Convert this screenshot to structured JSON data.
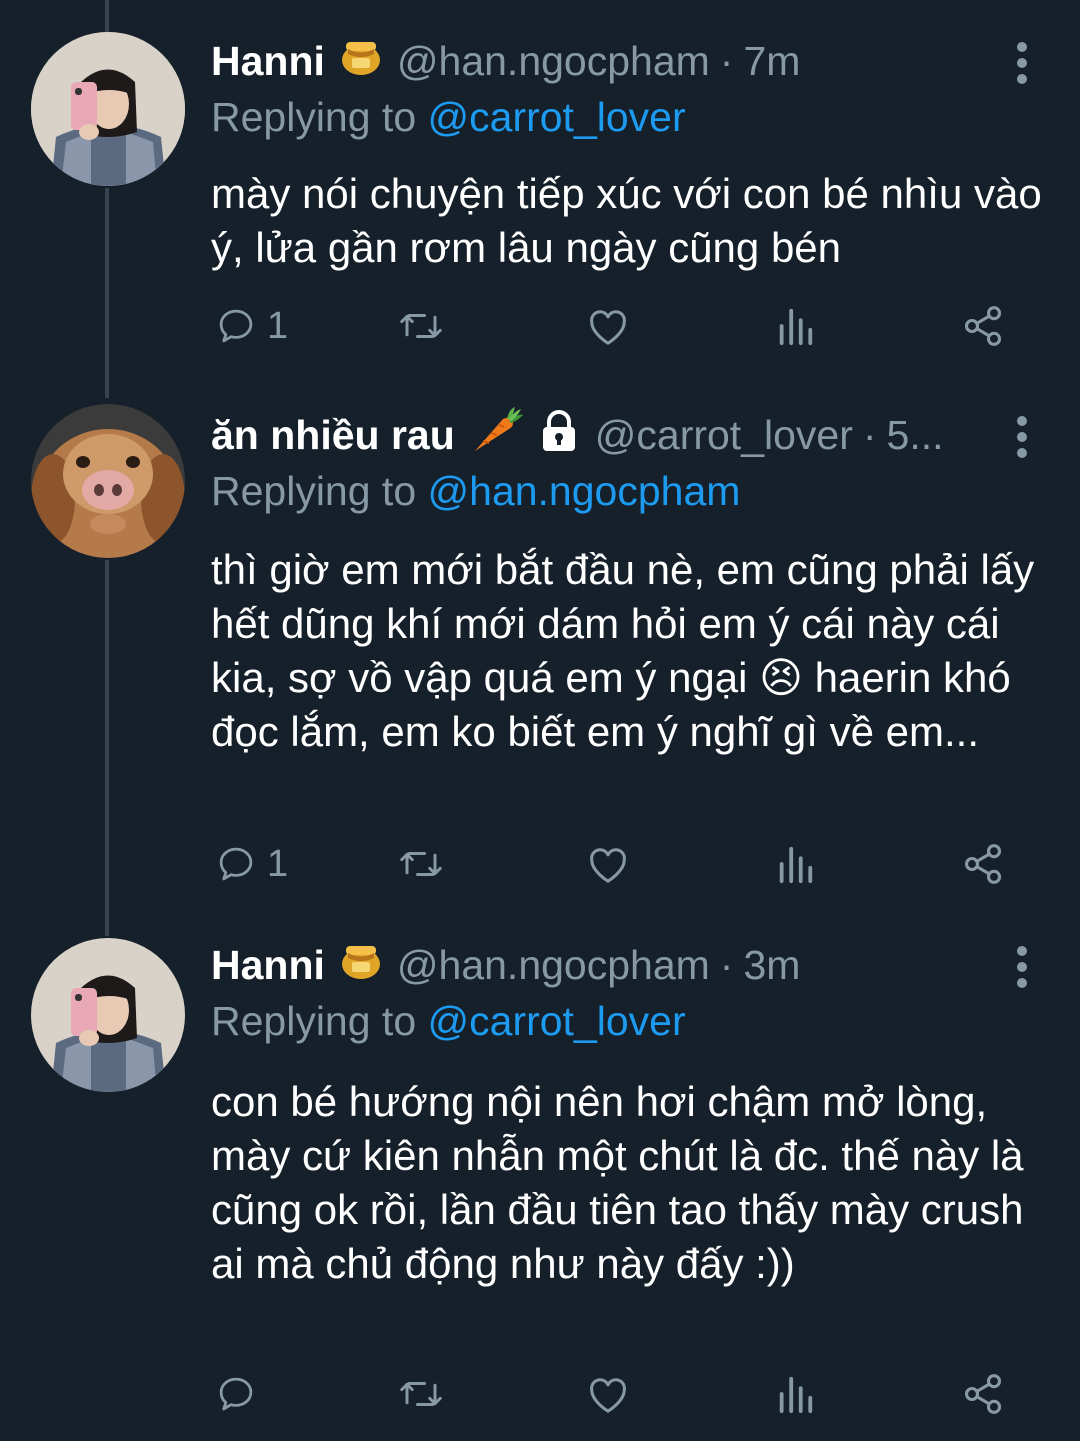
{
  "tweets": [
    {
      "name": "Hanni",
      "name_emoji": "honey-pot-emoji",
      "handle": "@han.ngocpham",
      "dot": "·",
      "time": "7m",
      "replying_prefix": "Replying to ",
      "replying_to": "@carrot_lover",
      "text": "mày nói chuyện tiếp xúc với con bé nhìu vào ý, lửa gần rơm lâu ngày cũng bén",
      "reply_count": "1"
    },
    {
      "name": "ăn nhiều rau",
      "name_emoji": "carrot-emoji",
      "locked": true,
      "handle": "@carrot_lover",
      "dot": "·",
      "time": "5...",
      "replying_prefix": "Replying to ",
      "replying_to": "@han.ngocpham",
      "text": "thì giờ em mới bắt đầu nè, em cũng phải lấy hết dũng khí mới dám hỏi em ý cái này cái kia, sợ vồ vập quá em ý ngại 😣 haerin khó đọc lắm, em ko biết em ý nghĩ gì về em...",
      "reply_count": "1"
    },
    {
      "name": "Hanni",
      "name_emoji": "honey-pot-emoji",
      "handle": "@han.ngocpham",
      "dot": "·",
      "time": "3m",
      "replying_prefix": "Replying to ",
      "replying_to": "@carrot_lover",
      "text": "con bé hướng nội nên hơi chậm mở lòng, mày cứ kiên nhẫn một chút là đc. thế này là cũng ok rồi, lần đầu tiên tao thấy mày crush ai mà chủ động như này đấy :))",
      "reply_count": ""
    }
  ],
  "colors": {
    "background": "#15202b",
    "secondary_text": "#8899a6",
    "mention": "#1d9bf0",
    "thread_line": "#38444d"
  },
  "action_icons": [
    "reply-icon",
    "retweet-icon",
    "like-icon",
    "views-icon",
    "share-icon"
  ]
}
